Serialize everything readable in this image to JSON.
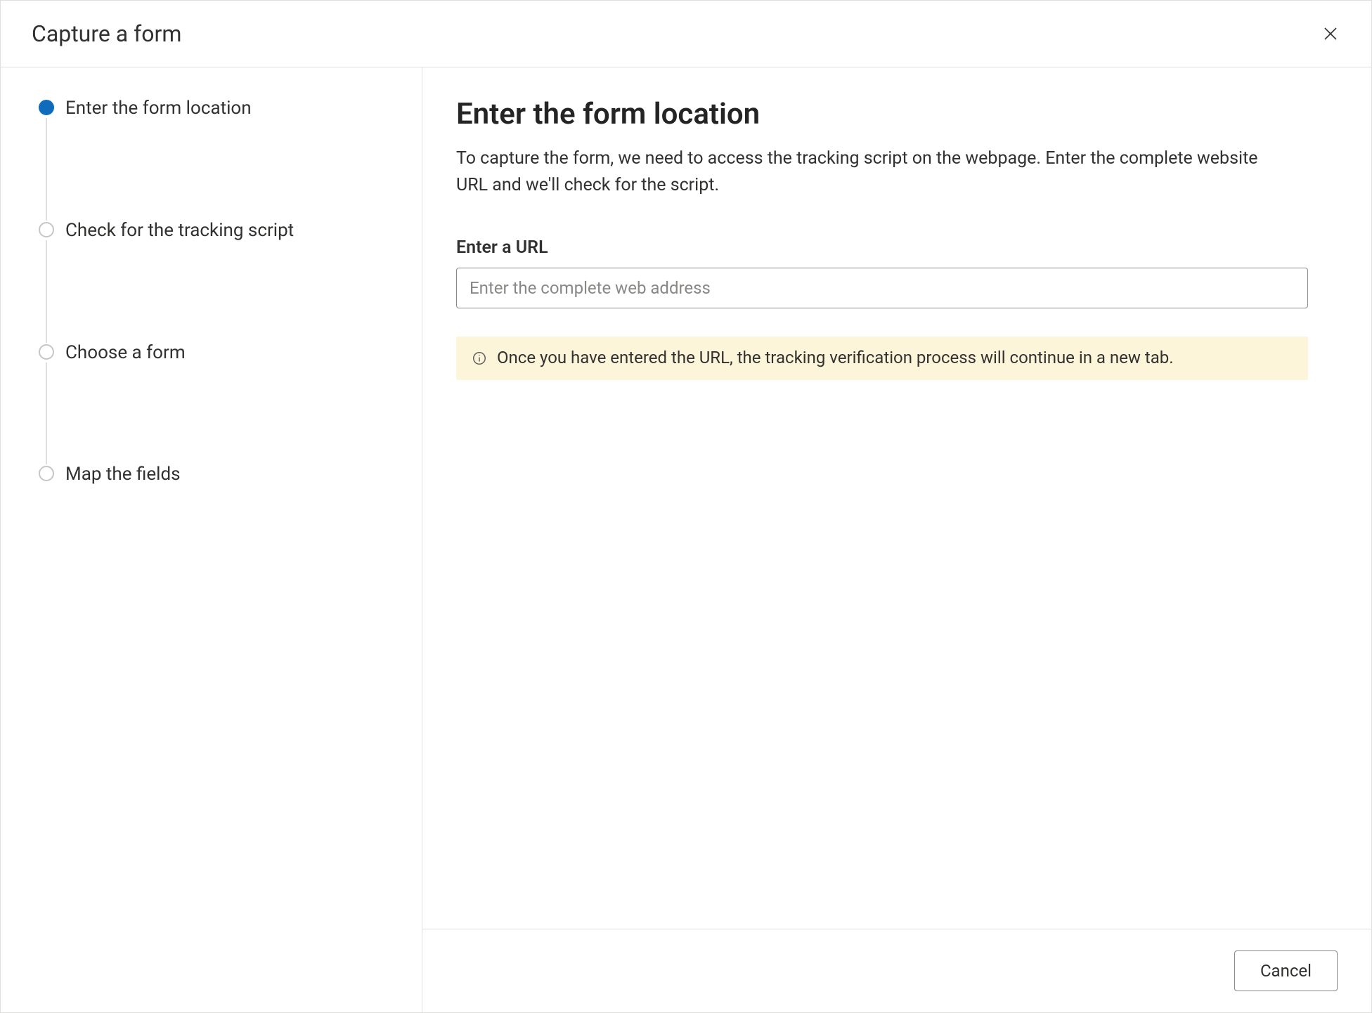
{
  "dialog": {
    "title": "Capture a form"
  },
  "sidebar": {
    "steps": [
      {
        "label": "Enter the form location",
        "active": true
      },
      {
        "label": "Check for the tracking script",
        "active": false
      },
      {
        "label": "Choose a form",
        "active": false
      },
      {
        "label": "Map the fields",
        "active": false
      }
    ]
  },
  "main": {
    "title": "Enter the form location",
    "description": "To capture the form, we need to access the tracking script on the webpage. Enter the complete website URL and we'll check for the script.",
    "url_field": {
      "label": "Enter a URL",
      "placeholder": "Enter the complete web address",
      "value": ""
    },
    "info_banner": "Once you have entered the URL, the tracking verification process will continue in a new tab."
  },
  "footer": {
    "cancel_label": "Cancel"
  }
}
